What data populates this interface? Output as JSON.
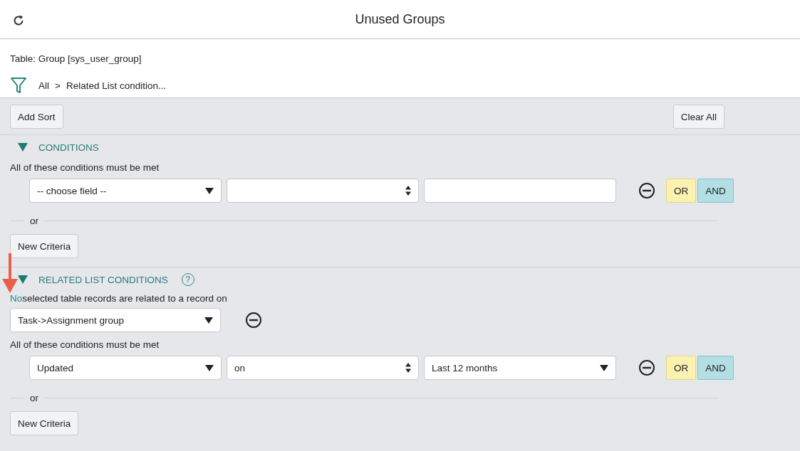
{
  "header": {
    "title": "Unused Groups"
  },
  "table_label": "Table: Group [sys_user_group]",
  "breadcrumb": {
    "root": "All",
    "separator": ">",
    "current": "Related List condition..."
  },
  "toolbar": {
    "add_sort": "Add Sort",
    "clear_all": "Clear All"
  },
  "conditions": {
    "heading": "CONDITIONS",
    "expanded": true,
    "rule": "All of these conditions must be met",
    "rows": [
      {
        "field": "-- choose field --",
        "value": {
          "kind": "text"
        },
        "or": "OR",
        "and": "AND"
      }
    ],
    "or_label": "or",
    "new_criteria": "New Criteria"
  },
  "related": {
    "heading": "RELATED LIST CONDITIONS",
    "help": "?",
    "expanded": true,
    "quantity": "No",
    "description": "selected table records are related to a record on",
    "related_list": "Task->Assignment group",
    "rule": "All of these conditions must be met",
    "rows": [
      {
        "field": "Updated",
        "operator": "on",
        "value": {
          "kind": "select",
          "text": "Last 12 months"
        },
        "or": "OR",
        "and": "AND"
      }
    ],
    "or_label": "or",
    "new_criteria": "New Criteria"
  }
}
